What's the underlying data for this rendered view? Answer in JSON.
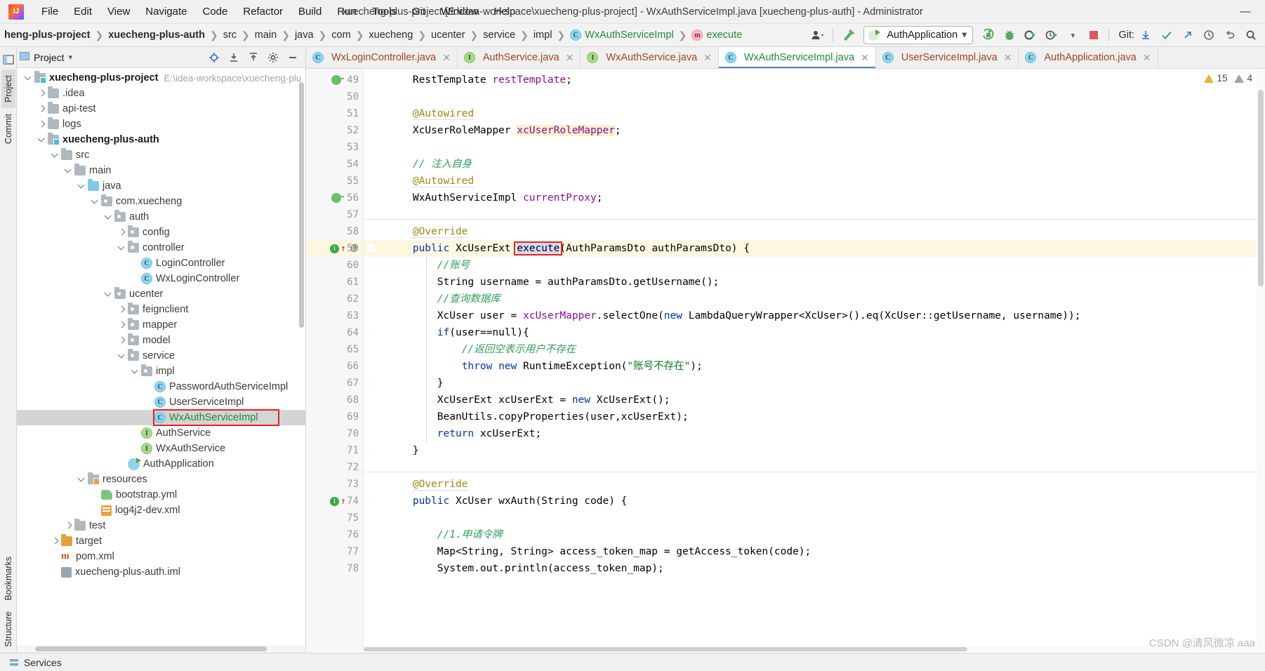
{
  "window": {
    "title": "xuecheng-plus-project [E:\\idea-workspace\\xuecheng-plus-project] - WxAuthServiceImpl.java [xuecheng-plus-auth] - Administrator",
    "minimize": "—",
    "maximize": "□",
    "close": "✕"
  },
  "menu": [
    {
      "label": "File"
    },
    {
      "label": "Edit"
    },
    {
      "label": "View"
    },
    {
      "label": "Navigate"
    },
    {
      "label": "Code"
    },
    {
      "label": "Refactor"
    },
    {
      "label": "Build"
    },
    {
      "label": "Run"
    },
    {
      "label": "Tools"
    },
    {
      "label": "Git"
    },
    {
      "label": "Window"
    },
    {
      "label": "Help"
    }
  ],
  "breadcrumb": {
    "items": [
      {
        "label": "heng-plus-project",
        "style": "bold",
        "icon": ""
      },
      {
        "label": "xuecheng-plus-auth",
        "style": "bold",
        "icon": ""
      },
      {
        "label": "src",
        "style": "",
        "icon": ""
      },
      {
        "label": "main",
        "style": "",
        "icon": ""
      },
      {
        "label": "java",
        "style": "",
        "icon": ""
      },
      {
        "label": "com",
        "style": "",
        "icon": ""
      },
      {
        "label": "xuecheng",
        "style": "",
        "icon": ""
      },
      {
        "label": "ucenter",
        "style": "",
        "icon": ""
      },
      {
        "label": "service",
        "style": "",
        "icon": ""
      },
      {
        "label": "impl",
        "style": "",
        "icon": ""
      },
      {
        "label": "WxAuthServiceImpl",
        "style": "green",
        "icon": "class-icon"
      },
      {
        "label": "execute",
        "style": "green",
        "icon": "method-icon"
      }
    ],
    "separator": "❯"
  },
  "toolbar": {
    "profile_icon": "user-profile-icon",
    "build_icon": "hammer-build-icon",
    "run_config": "AuthApplication",
    "dropdown_caret": "▾",
    "run_icon": "run-icon",
    "debug_icon": "debug-icon",
    "run_coverage_icon": "run-with-coverage-icon",
    "profiler_icon": "profiler-icon",
    "stop_icon": "stop-icon",
    "git_label": "Git:",
    "git_update_icon": "git-update-icon",
    "git_commit_icon": "git-commit-check-icon",
    "git_push_icon": "git-push-icon",
    "history_icon": "history-icon",
    "undo_icon": "undo-icon",
    "search_icon": "search-icon"
  },
  "left_strip": {
    "project_tab": "Project",
    "commit_tab": "Commit",
    "bookmarks_tab": "Bookmarks",
    "structure_tab": "Structure"
  },
  "project_panel": {
    "title": "Project",
    "caret": "▾",
    "locate_icon": "locate-target-icon",
    "expand_icon": "expand-all-icon",
    "collapse_icon": "collapse-all-icon",
    "settings_icon": "gear-icon",
    "hide_icon": "hide-panel-icon",
    "tree": [
      {
        "depth": 0,
        "arrow": "open",
        "icon": "module-folder",
        "label": "xuecheng-plus-project",
        "style": "bold",
        "hint": "E:\\idea-workspace\\xuecheng-plu"
      },
      {
        "depth": 1,
        "arrow": "closed",
        "icon": "folder",
        "label": ".idea",
        "style": "",
        "hint": ""
      },
      {
        "depth": 1,
        "arrow": "closed",
        "icon": "folder",
        "label": "api-test",
        "style": "",
        "hint": ""
      },
      {
        "depth": 1,
        "arrow": "closed",
        "icon": "folder",
        "label": "logs",
        "style": "",
        "hint": ""
      },
      {
        "depth": 1,
        "arrow": "open",
        "icon": "module-folder",
        "label": "xuecheng-plus-auth",
        "style": "bold",
        "hint": ""
      },
      {
        "depth": 2,
        "arrow": "open",
        "icon": "folder",
        "label": "src",
        "style": "",
        "hint": ""
      },
      {
        "depth": 3,
        "arrow": "open",
        "icon": "folder",
        "label": "main",
        "style": "",
        "hint": ""
      },
      {
        "depth": 4,
        "arrow": "open",
        "icon": "source-folder",
        "label": "java",
        "style": "",
        "hint": ""
      },
      {
        "depth": 5,
        "arrow": "open",
        "icon": "package",
        "label": "com.xuecheng",
        "style": "",
        "hint": ""
      },
      {
        "depth": 6,
        "arrow": "open",
        "icon": "package",
        "label": "auth",
        "style": "",
        "hint": ""
      },
      {
        "depth": 7,
        "arrow": "closed",
        "icon": "package",
        "label": "config",
        "style": "",
        "hint": ""
      },
      {
        "depth": 7,
        "arrow": "open",
        "icon": "package",
        "label": "controller",
        "style": "",
        "hint": ""
      },
      {
        "depth": 8,
        "arrow": "none",
        "icon": "class",
        "label": "LoginController",
        "style": "class",
        "hint": ""
      },
      {
        "depth": 8,
        "arrow": "none",
        "icon": "class",
        "label": "WxLoginController",
        "style": "class",
        "hint": ""
      },
      {
        "depth": 6,
        "arrow": "open",
        "icon": "package",
        "label": "ucenter",
        "style": "",
        "hint": ""
      },
      {
        "depth": 7,
        "arrow": "closed",
        "icon": "package",
        "label": "feignclient",
        "style": "",
        "hint": ""
      },
      {
        "depth": 7,
        "arrow": "closed",
        "icon": "package",
        "label": "mapper",
        "style": "",
        "hint": ""
      },
      {
        "depth": 7,
        "arrow": "closed",
        "icon": "package",
        "label": "model",
        "style": "",
        "hint": ""
      },
      {
        "depth": 7,
        "arrow": "open",
        "icon": "package",
        "label": "service",
        "style": "",
        "hint": ""
      },
      {
        "depth": 8,
        "arrow": "open",
        "icon": "package",
        "label": "impl",
        "style": "",
        "hint": ""
      },
      {
        "depth": 9,
        "arrow": "none",
        "icon": "class",
        "label": "PasswordAuthServiceImpl",
        "style": "class",
        "hint": ""
      },
      {
        "depth": 9,
        "arrow": "none",
        "icon": "class",
        "label": "UserServiceImpl",
        "style": "class",
        "hint": ""
      },
      {
        "depth": 9,
        "arrow": "none",
        "icon": "class",
        "label": "WxAuthServiceImpl",
        "style": "green",
        "hint": "",
        "selected": true,
        "boxed": true
      },
      {
        "depth": 8,
        "arrow": "none",
        "icon": "interface",
        "label": "AuthService",
        "style": "class",
        "hint": ""
      },
      {
        "depth": 8,
        "arrow": "none",
        "icon": "interface",
        "label": "WxAuthService",
        "style": "class",
        "hint": ""
      },
      {
        "depth": 7,
        "arrow": "none",
        "icon": "spring-class",
        "label": "AuthApplication",
        "style": "class",
        "hint": ""
      },
      {
        "depth": 4,
        "arrow": "open",
        "icon": "resource-folder",
        "label": "resources",
        "style": "",
        "hint": ""
      },
      {
        "depth": 5,
        "arrow": "none",
        "icon": "yml",
        "label": "bootstrap.yml",
        "style": "class",
        "hint": ""
      },
      {
        "depth": 5,
        "arrow": "none",
        "icon": "xml",
        "label": "log4j2-dev.xml",
        "style": "class",
        "hint": ""
      },
      {
        "depth": 3,
        "arrow": "closed",
        "icon": "folder",
        "label": "test",
        "style": "",
        "hint": ""
      },
      {
        "depth": 2,
        "arrow": "closed",
        "icon": "target-folder",
        "label": "target",
        "style": "",
        "hint": ""
      },
      {
        "depth": 2,
        "arrow": "none",
        "icon": "maven",
        "label": "pom.xml",
        "style": "class",
        "hint": ""
      },
      {
        "depth": 2,
        "arrow": "none",
        "icon": "iml",
        "label": "xuecheng-plus-auth.iml",
        "style": "class",
        "hint": ""
      }
    ]
  },
  "editor_tabs": [
    {
      "label": "WxLoginController.java",
      "icon": "class-icon",
      "active": false,
      "close": "✕"
    },
    {
      "label": "AuthService.java",
      "icon": "interface-icon",
      "active": false,
      "close": "✕"
    },
    {
      "label": "WxAuthService.java",
      "icon": "interface-icon",
      "active": false,
      "close": "✕"
    },
    {
      "label": "WxAuthServiceImpl.java",
      "icon": "class-icon",
      "active": true,
      "close": "✕"
    },
    {
      "label": "UserServiceImpl.java",
      "icon": "class-icon",
      "active": false,
      "close": "✕"
    },
    {
      "label": "AuthApplication.java",
      "icon": "class-icon",
      "active": false,
      "close": "✕"
    }
  ],
  "inspection": {
    "warning_count": "15",
    "weak_warning_count": "4"
  },
  "code": {
    "first_line_number": 49,
    "lines": [
      {
        "n": 49,
        "text": "        RestTemplate restTemplate;"
      },
      {
        "n": 50,
        "text": ""
      },
      {
        "n": 51,
        "text": "        @Autowired"
      },
      {
        "n": 52,
        "text": "        XcUserRoleMapper xcUserRoleMapper;"
      },
      {
        "n": 53,
        "text": ""
      },
      {
        "n": 54,
        "text": "        // 注入自身"
      },
      {
        "n": 55,
        "text": "        @Autowired"
      },
      {
        "n": 56,
        "text": "        WxAuthServiceImpl currentProxy;"
      },
      {
        "n": 57,
        "text": ""
      },
      {
        "n": 58,
        "text": "        @Override"
      },
      {
        "n": 59,
        "text": "        public XcUserExt execute(AuthParamsDto authParamsDto) {"
      },
      {
        "n": 60,
        "text": "            //账号"
      },
      {
        "n": 61,
        "text": "            String username = authParamsDto.getUsername();"
      },
      {
        "n": 62,
        "text": "            //查询数据库"
      },
      {
        "n": 63,
        "text": "            XcUser user = xcUserMapper.selectOne(new LambdaQueryWrapper<XcUser>().eq(XcUser::getUsername, username));"
      },
      {
        "n": 64,
        "text": "            if(user==null){"
      },
      {
        "n": 65,
        "text": "                //返回空表示用户不存在"
      },
      {
        "n": 66,
        "text": "                throw new RuntimeException(\"账号不存在\");"
      },
      {
        "n": 67,
        "text": "            }"
      },
      {
        "n": 68,
        "text": "            XcUserExt xcUserExt = new XcUserExt();"
      },
      {
        "n": 69,
        "text": "            BeanUtils.copyProperties(user,xcUserExt);"
      },
      {
        "n": 70,
        "text": "            return xcUserExt;"
      },
      {
        "n": 71,
        "text": "        }"
      },
      {
        "n": 72,
        "text": ""
      },
      {
        "n": 73,
        "text": "        @Override"
      },
      {
        "n": 74,
        "text": "        public XcUser wxAuth(String code) {"
      },
      {
        "n": 75,
        "text": ""
      },
      {
        "n": 76,
        "text": "            //1.申请令牌"
      },
      {
        "n": 77,
        "text": "            Map<String, String> access_token_map = getAccess_token(code);"
      },
      {
        "n": 78,
        "text": "            System.out.println(access_token_map);"
      }
    ],
    "current_line": 59,
    "highlighted_symbol": "execute",
    "highlighted_field": "xcUserRoleMapper"
  },
  "status_bar": {
    "services_label": "Services",
    "watermark": "CSDN @清风微凉 aaa"
  }
}
